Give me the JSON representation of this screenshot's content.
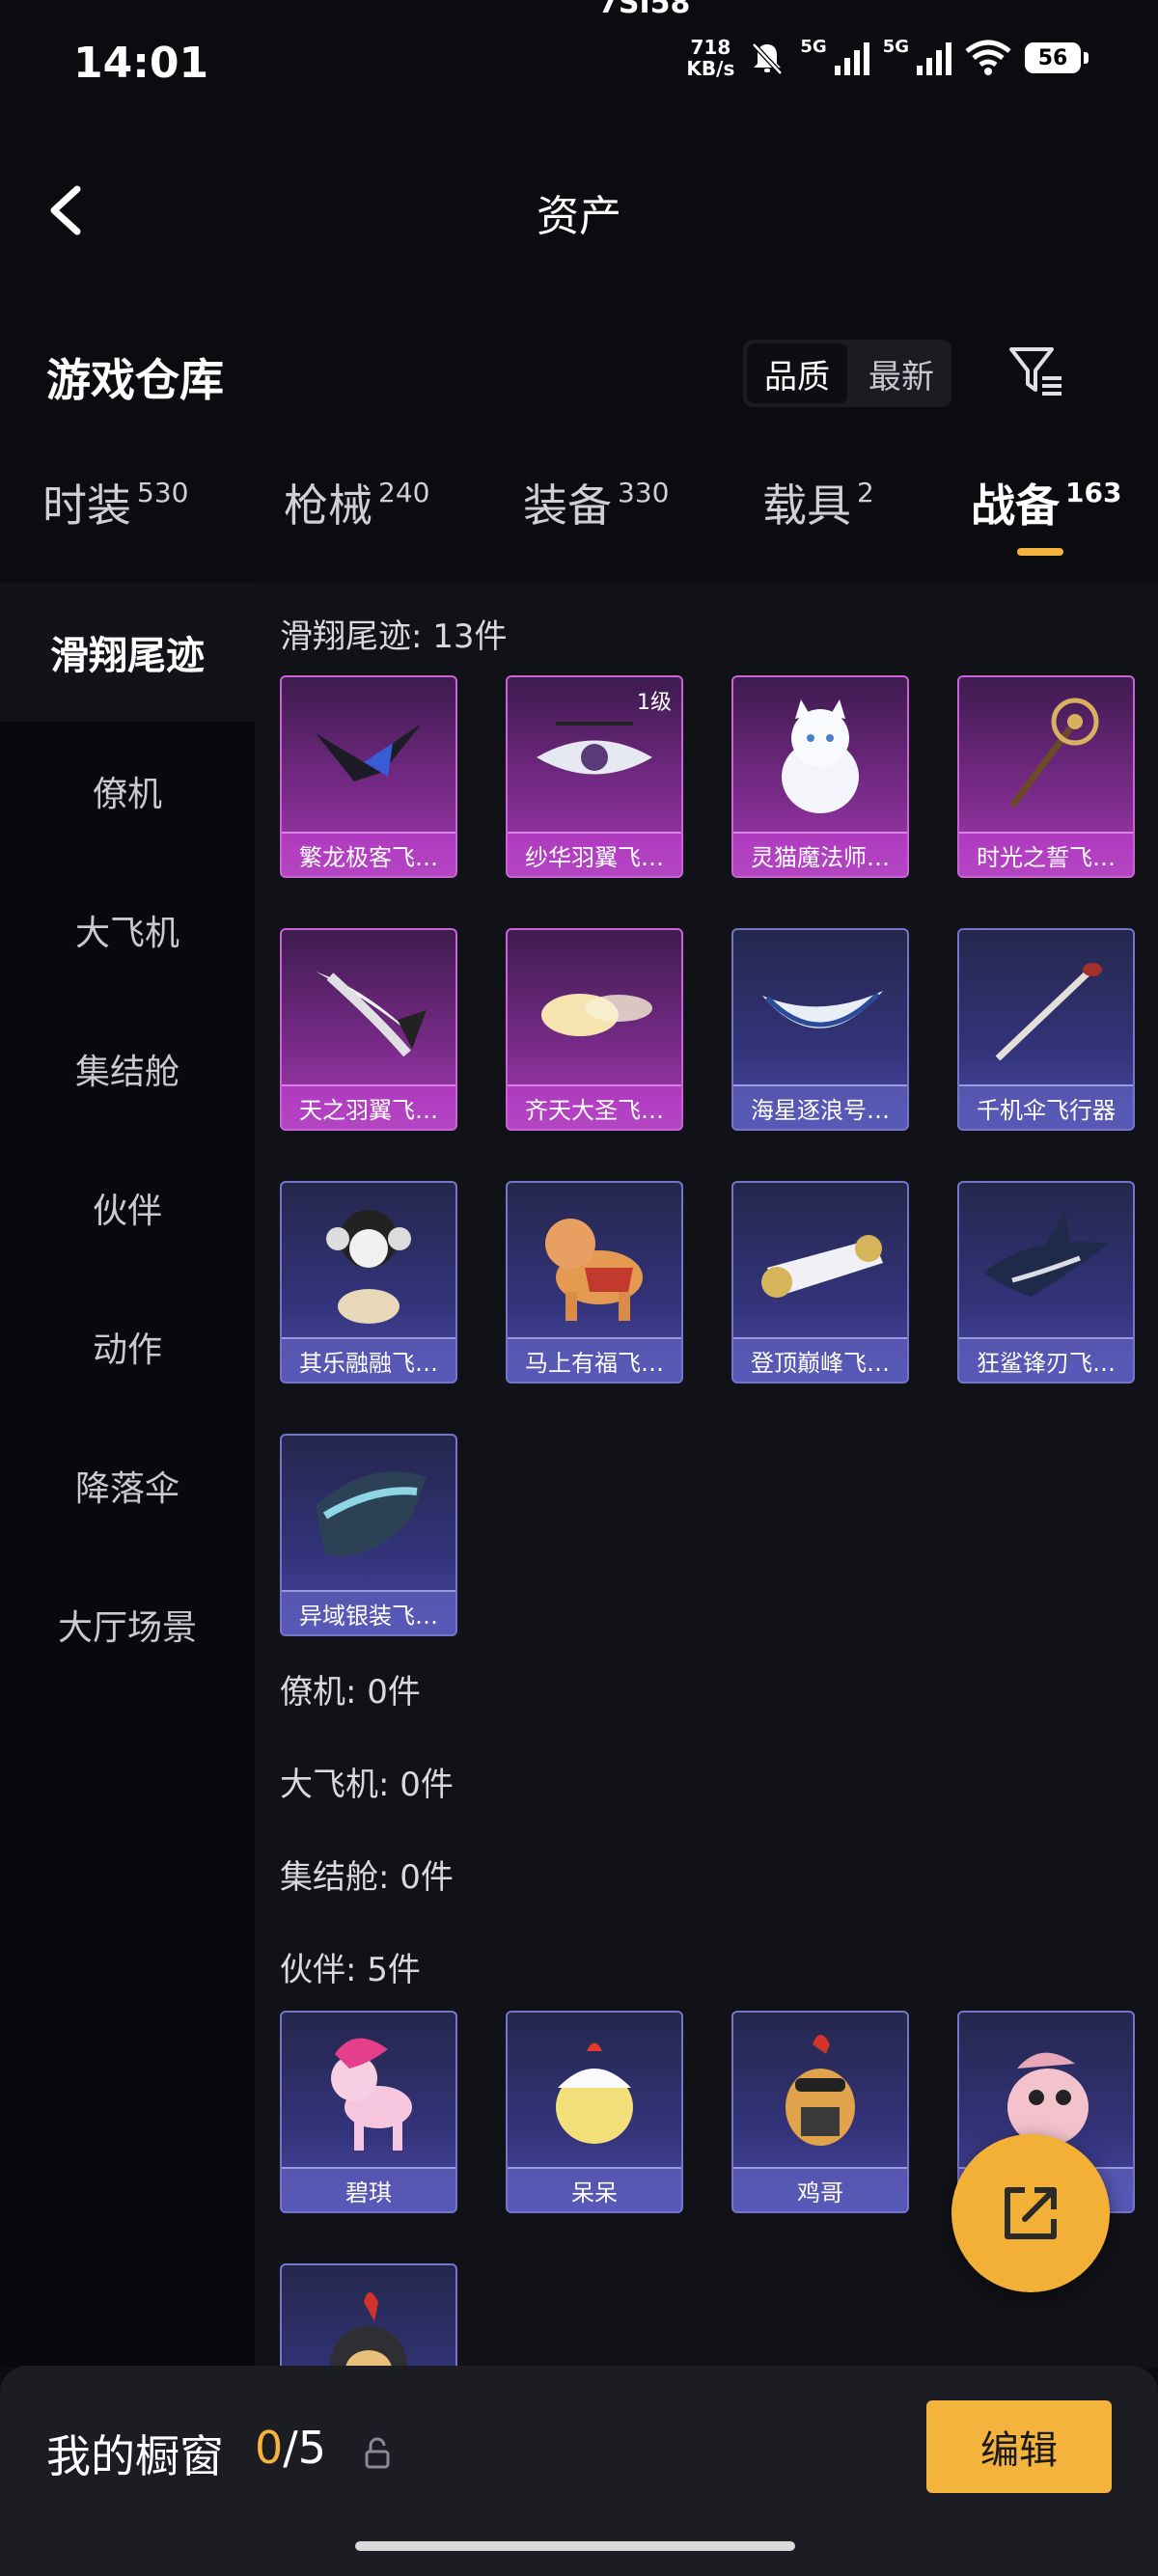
{
  "status_bar": {
    "time": "14:01",
    "carrier_text": "7SI58",
    "speed_top": "718",
    "speed_unit": "KB/s",
    "net1": "5G",
    "net2": "5G",
    "battery": "56"
  },
  "header": {
    "title": "资产"
  },
  "section": {
    "title": "游戏仓库",
    "sort_options": [
      "品质",
      "最新"
    ],
    "sort_active": "品质"
  },
  "tabs": [
    {
      "label": "时装",
      "count": "530"
    },
    {
      "label": "枪械",
      "count": "240"
    },
    {
      "label": "装备",
      "count": "330"
    },
    {
      "label": "载具",
      "count": "2"
    },
    {
      "label": "战备",
      "count": "163",
      "active": true
    }
  ],
  "sidebar": [
    {
      "label": "滑翔尾迹",
      "active": true
    },
    {
      "label": "僚机"
    },
    {
      "label": "大飞机"
    },
    {
      "label": "集结舱"
    },
    {
      "label": "伙伴"
    },
    {
      "label": "动作"
    },
    {
      "label": "降落伞"
    },
    {
      "label": "大厅场景"
    }
  ],
  "groups": {
    "glide": {
      "header": "滑翔尾迹: 13件",
      "items": [
        {
          "name": "繁龙极客飞…",
          "rarity": "purple"
        },
        {
          "name": "纱华羽翼飞…",
          "rarity": "purple",
          "level": "1级"
        },
        {
          "name": "灵猫魔法师…",
          "rarity": "purple"
        },
        {
          "name": "时光之誓飞…",
          "rarity": "purple"
        },
        {
          "name": "天之羽翼飞…",
          "rarity": "purple"
        },
        {
          "name": "齐天大圣飞…",
          "rarity": "purple"
        },
        {
          "name": "海星逐浪号…",
          "rarity": "blue"
        },
        {
          "name": "千机伞飞行器",
          "rarity": "blue"
        },
        {
          "name": "其乐融融飞…",
          "rarity": "blue"
        },
        {
          "name": "马上有福飞…",
          "rarity": "blue"
        },
        {
          "name": "登顶巅峰飞…",
          "rarity": "blue"
        },
        {
          "name": "狂鲨锋刃飞…",
          "rarity": "blue"
        },
        {
          "name": "异域银装飞…",
          "rarity": "blue"
        }
      ]
    },
    "wingman": {
      "header": "僚机: 0件"
    },
    "big_plane": {
      "header": "大飞机: 0件"
    },
    "assembly": {
      "header": "集结舱: 0件"
    },
    "partner": {
      "header": "伙伴: 5件",
      "items": [
        {
          "name": "碧琪",
          "rarity": "blue"
        },
        {
          "name": "呆呆",
          "rarity": "blue"
        },
        {
          "name": "鸡哥",
          "rarity": "blue"
        },
        {
          "name": "",
          "rarity": "blue"
        },
        {
          "name": "",
          "rarity": "blue"
        }
      ]
    }
  },
  "showcase": {
    "label": "我的橱窗",
    "current": "0",
    "total": "/5",
    "edit_label": "编辑"
  },
  "colors": {
    "accent": "#f3b33d",
    "purple_card": "#a53cb4",
    "blue_card": "#5858b8"
  },
  "icons": [
    "back-arrow-icon",
    "filter-icon",
    "share-icon",
    "lock-icon"
  ]
}
